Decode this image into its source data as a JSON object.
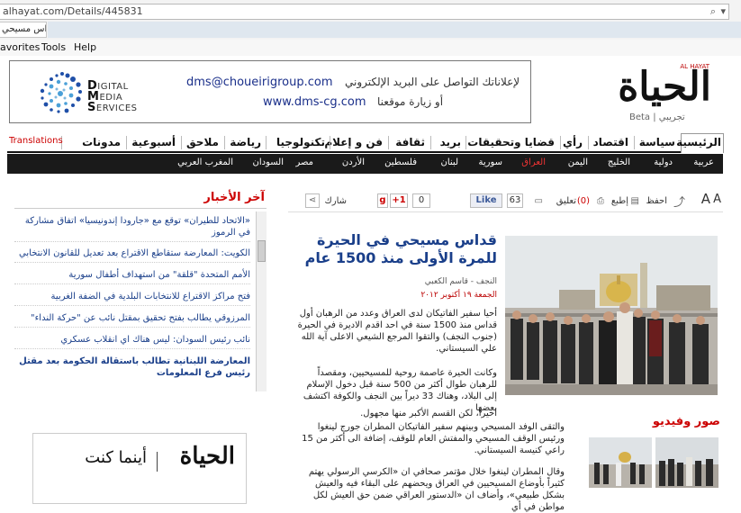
{
  "browser": {
    "url": "alhayat.com/Details/445831",
    "tab_title": "قداس مسيحي",
    "tab_close": "×",
    "menu": [
      "avorites",
      "Tools",
      "Help"
    ]
  },
  "ad": {
    "dms_line1": "IGITAL",
    "dms_line2": "EDIA",
    "dms_line3": "ERVICES",
    "dms_d": "D",
    "dms_m": "M",
    "dms_s": "S",
    "email_label": "لإعلاناتك التواصل على البريد الإلكتروني",
    "email": "dms@choueirigroup.com",
    "site_label": "أو زيارة موقعنا",
    "site": "www.dms-cg.com"
  },
  "logo": {
    "main": "الحياة",
    "small": "AL HAYAT",
    "beta": "Beta | تجريبي"
  },
  "nav": [
    "الرئيسية",
    "سياسة",
    "اقتصاد",
    "رأي",
    "قضايا وتحقيقات",
    "بريد",
    "ثقافة",
    "فن و إعلام",
    "تكنولوجيا",
    "رياضة",
    "ملاحق",
    "أسبوعية",
    "مدونات",
    "Translations"
  ],
  "subnav": [
    "عربية",
    "دولية",
    "الخليج",
    "اليمن",
    "العراق",
    "سورية",
    "لبنان",
    "فلسطين",
    "الأردن",
    "السودان",
    "مصر",
    "المغرب العربي"
  ],
  "toolbar": {
    "font_up": "A",
    "font_down": "A",
    "save": "احفظ",
    "print": "إطبع",
    "comment": "تعليق",
    "comment_count": "(0)",
    "like_count": "63",
    "like": "Like",
    "gplus_count": "0",
    "gplus": "+1",
    "share": "شارك"
  },
  "article": {
    "headline": "قداس مسيحي في الحيرة للمرة الأولى منذ 1500 عام",
    "byline": "النجف - قاسم الكعبي",
    "date": "الجمعة ١٩ أكتوبر ٢٠١٢",
    "para1": "أحيا سفير الفاتيكان لدى العراق وعدد من الرهبان أول قداس منذ 1500 سنة في احد اقدم الاديرة في الحيرة (جنوب النجف) والتقوا المرجع الشيعي الاعلى آية الله علي السيستاني.",
    "para2": "وكانت الحيرة عاصمة روحية للمسيحيين، ومقصداً للرهبان طوال أكثر من 500 سنة قبل دخول الإسلام إلى البلاد، وهناك 33 ديراً بين النجف والكوفة اكتشف بعضها",
    "para3": "اخيراً، لكن القسم الأكبر منها مجهول.",
    "para4": "والتقى الوفد المسيحي وبينهم سفير الفاتيكان المطران جورج لينغوا ورئيس الوقف المسيحي والمفتش العام للوقف، إضافة الى أكثر من 15 راعي كنيسة السيستاني.",
    "para5": "وقال المطران لينغوا خلال مؤتمر صحافي ان «الكرسي الرسولي يهتم كثيراً بأوضاع المسيحيين في العراق ويحضهم على البقاء فيه والعيش بشكل طبيعي»، وأضاف ان «الدستور العراقي ضمن حق العيش لكل مواطن في أي"
  },
  "news": {
    "title": "آخر الأخبار",
    "items": [
      "«الاتحاد للطيران» توقع مع «جارودا إندونيسيا» اتفاق مشاركة في الرموز",
      "الكويت: المعارضة ستقاطع الاقتراع بعد تعديل للقانون الانتخابي",
      "الأمم المتحدة \"قلقة\" من استهداف أطفال سورية",
      "فتح مراكز الاقتراع للانتخابات البلدية في الضفة الغربية",
      "المرزوقي يطالب بفتح تحقيق بمقتل نائب عن \"حركة النداء\"",
      "نائب رئيس السودان: ليس هناك اي انقلاب عسكري",
      "المعارضة اللبنانية تطالب باستقالة الحكومة بعد مقتل رئيس فرع المعلومات"
    ]
  },
  "promo": {
    "logo": "الحياة",
    "tagline": "أينما كنت"
  },
  "media": {
    "title": "صور وفيديو"
  },
  "colors": {
    "accent_red": "#c00000",
    "link_blue": "#1a3f8a",
    "subnav_bg": "#1a1a1a"
  }
}
